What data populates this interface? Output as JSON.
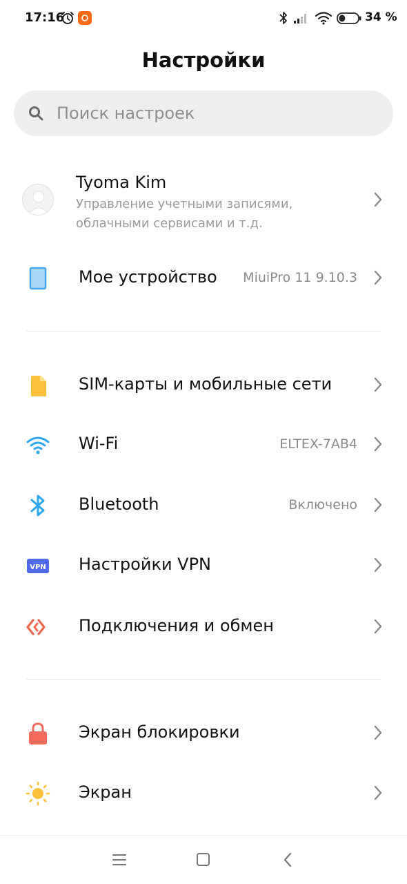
{
  "status_bar": {
    "time": "17:16",
    "battery": "34 %",
    "battery_level": 0.34,
    "app_icon_color": "#ff6a1a"
  },
  "header": {
    "title": "Настройки"
  },
  "search": {
    "placeholder": "Поиск настроек",
    "value": ""
  },
  "account": {
    "name": "Tyoma Kim",
    "subtitle": "Управление учетными записями, облачными сервисами и т.д."
  },
  "sections": [
    {
      "items": [
        {
          "label": "Мое устройство",
          "value": "MiuiPro 11 9.10.3",
          "icon": "tablet-icon",
          "color": "#4aa8e8"
        }
      ]
    },
    {
      "items": [
        {
          "label": "SIM-карты и мобильные сети",
          "value": "",
          "icon": "sim-card-icon",
          "color": "#f9c13a"
        },
        {
          "label": "Wi-Fi",
          "value": "ELTEX-7AB4",
          "icon": "wifi-icon",
          "color": "#2ea5ef"
        },
        {
          "label": "Bluetooth",
          "value": "Включено",
          "icon": "bluetooth-icon",
          "color": "#2ea5ef"
        },
        {
          "label": "Настройки VPN",
          "value": "",
          "icon": "vpn-icon",
          "icon_text": "VPN",
          "color": "#4f6bea"
        },
        {
          "label": "Подключения и обмен",
          "value": "",
          "icon": "share-arrows-icon",
          "color": "#f0674f"
        }
      ]
    },
    {
      "items": [
        {
          "label": "Экран блокировки",
          "value": "",
          "icon": "lock-icon",
          "color": "#f36b5f"
        },
        {
          "label": "Экран",
          "value": "",
          "icon": "sun-icon",
          "color": "#f9c13a"
        }
      ]
    }
  ],
  "nav_bar": {
    "buttons": [
      "menu-icon",
      "home-icon",
      "back-icon"
    ]
  }
}
